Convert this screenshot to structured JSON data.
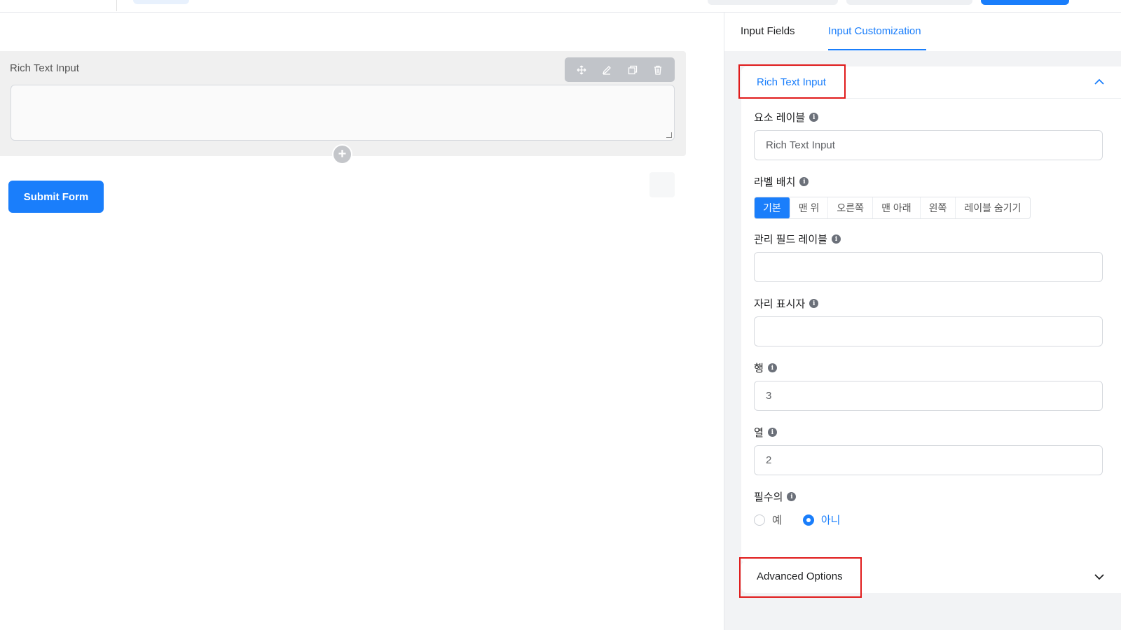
{
  "tabs": {
    "input_fields": "Input Fields",
    "input_customization": "Input Customization"
  },
  "editor": {
    "field_label": "Rich Text Input",
    "submit_label": "Submit Form"
  },
  "panel": {
    "section_title": "Rich Text Input",
    "element_label": {
      "label": "요소 레이블",
      "value": "Rich Text Input"
    },
    "label_placement": {
      "label": "라벨 배치",
      "options": [
        "기본",
        "맨 위",
        "오른쪽",
        "맨 아래",
        "왼쪽",
        "레이블 숨기기"
      ],
      "selected": "기본"
    },
    "admin_label": {
      "label": "관리 필드 레이블",
      "value": ""
    },
    "placeholder": {
      "label": "자리 표시자",
      "value": ""
    },
    "rows": {
      "label": "행",
      "value": "3"
    },
    "cols": {
      "label": "열",
      "value": "2"
    },
    "required": {
      "label": "필수의",
      "yes": "예",
      "no": "아니",
      "selected": "아니"
    },
    "advanced_title": "Advanced Options"
  },
  "colors": {
    "accent": "#1a7efb",
    "highlight": "#e01b1b"
  }
}
